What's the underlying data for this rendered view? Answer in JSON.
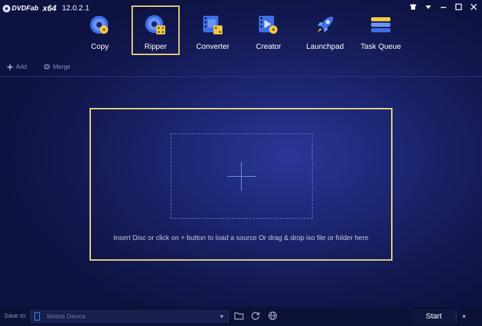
{
  "app": {
    "brand": "DVDFab",
    "arch": "x64",
    "version": "12.0.2.1"
  },
  "toolbar": {
    "items": [
      {
        "label": "Copy",
        "icon": "copy-disc-icon"
      },
      {
        "label": "Ripper",
        "icon": "ripper-disc-icon",
        "selected": true
      },
      {
        "label": "Converter",
        "icon": "converter-film-icon"
      },
      {
        "label": "Creator",
        "icon": "creator-film-icon"
      },
      {
        "label": "Launchpad",
        "icon": "rocket-icon"
      },
      {
        "label": "Task Queue",
        "icon": "task-queue-icon"
      }
    ]
  },
  "actions": {
    "add_label": "Add",
    "merge_label": "Merge"
  },
  "dropzone": {
    "hint": "Insert Disc or click on + button to load a source Or drag & drop iso file or folder here"
  },
  "bottom": {
    "save_to_label": "Save to:",
    "device_value": "Mobile Device",
    "start_label": "Start"
  },
  "colors": {
    "accent_border": "#eddb86",
    "dashed_border": "#4f7ad8",
    "background": "#1e2876"
  }
}
